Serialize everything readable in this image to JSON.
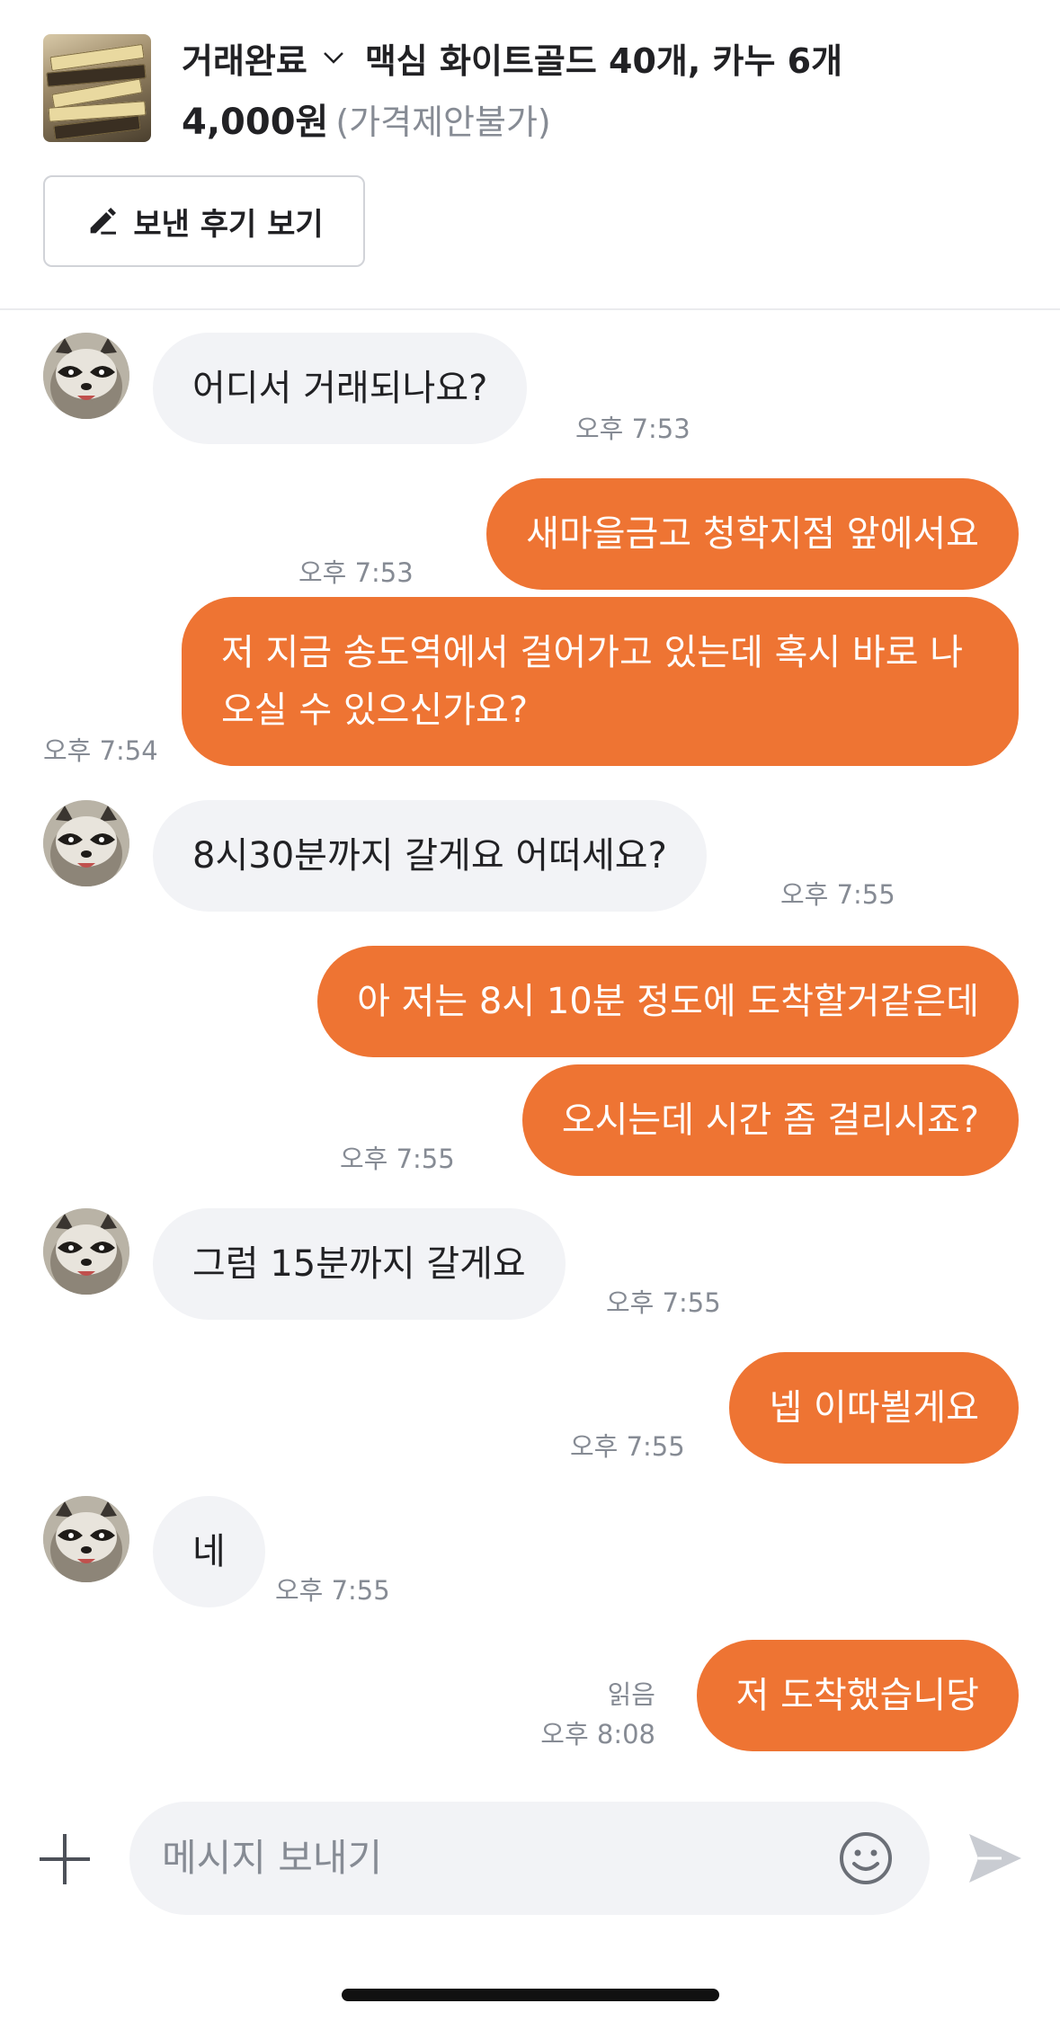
{
  "header": {
    "status": "거래완료",
    "item_title": "맥심 화이트골드 40개, 카누 6개",
    "price": "4,000원",
    "price_note": "(가격제안불가)",
    "review_button": "보낸 후기 보기"
  },
  "messages": [
    {
      "side": "in",
      "text": "어디서 거래되나요?",
      "time": "오후 7:53"
    },
    {
      "side": "out",
      "text": "새마을금고 청학지점 앞에서요",
      "time": "오후 7:53"
    },
    {
      "side": "out",
      "text": "저 지금 송도역에서 걸어가고 있는데 혹시 바로 나오실 수 있으신가요?",
      "time": "오후 7:54"
    },
    {
      "side": "in",
      "text": "8시30분까지 갈게요 어떠세요?",
      "time": "오후 7:55"
    },
    {
      "side": "out",
      "text": "아 저는 8시 10분 정도에 도착할거같은데",
      "time": ""
    },
    {
      "side": "out",
      "text": "오시는데 시간 좀 걸리시죠?",
      "time": "오후 7:55"
    },
    {
      "side": "in",
      "text": "그럼 15분까지 갈게요",
      "time": "오후 7:55"
    },
    {
      "side": "out",
      "text": "넵 이따뵐게요",
      "time": "오후 7:55"
    },
    {
      "side": "in",
      "text": "네",
      "time": "오후 7:55"
    },
    {
      "side": "out",
      "text": "저 도착했습니당",
      "time": "오후 8:08",
      "read": "읽음"
    }
  ],
  "composer": {
    "placeholder": "메시지 보내기"
  },
  "icons": {
    "status_dropdown": "chevron-down-icon",
    "review": "pencil-icon",
    "attach": "plus-icon",
    "emoji": "smile-icon",
    "send": "send-icon",
    "avatar": "raccoon-avatar"
  },
  "colors": {
    "outgoing_bubble": "#ee7433",
    "incoming_bubble": "#f2f3f6",
    "timestamp": "#868b94"
  }
}
